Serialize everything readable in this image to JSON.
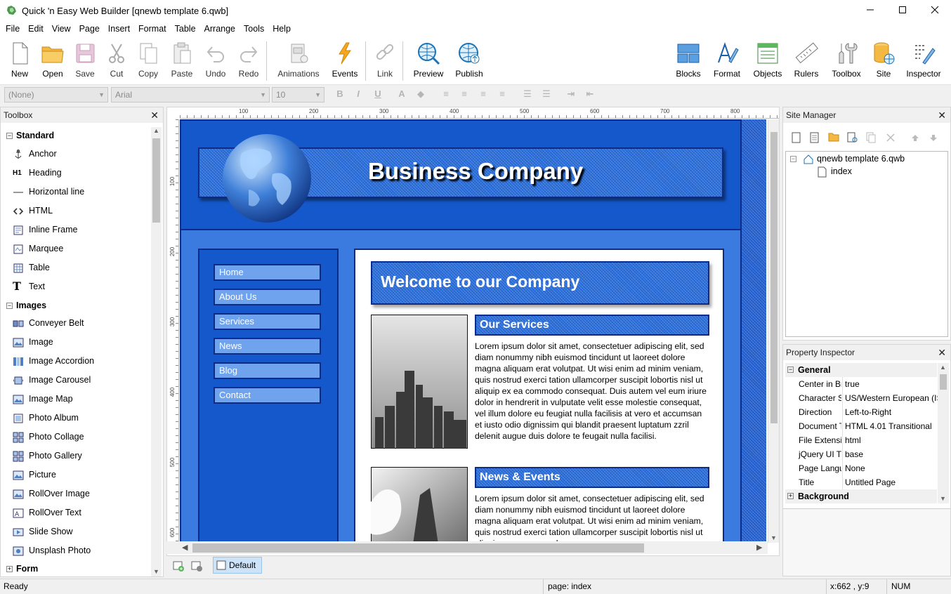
{
  "window": {
    "title": "Quick 'n Easy Web Builder [qnewb template 6.qwb]",
    "minimize": "—",
    "maximize": "☐",
    "close": "✕"
  },
  "menu": [
    "File",
    "Edit",
    "View",
    "Page",
    "Insert",
    "Format",
    "Table",
    "Arrange",
    "Tools",
    "Help"
  ],
  "toolbar": {
    "left": [
      {
        "label": "New",
        "icon": "new-page-icon",
        "enabled": true
      },
      {
        "label": "Open",
        "icon": "open-folder-icon",
        "enabled": true
      },
      {
        "label": "Save",
        "icon": "save-disk-icon",
        "enabled": false
      },
      {
        "label": "Cut",
        "icon": "scissors-icon",
        "enabled": false
      },
      {
        "label": "Copy",
        "icon": "copy-icon",
        "enabled": false
      },
      {
        "label": "Paste",
        "icon": "paste-icon",
        "enabled": false
      },
      {
        "label": "Undo",
        "icon": "undo-arrow-icon",
        "enabled": false
      },
      {
        "label": "Redo",
        "icon": "redo-arrow-icon",
        "enabled": false
      },
      {
        "label": "Animations",
        "icon": "film-icon",
        "enabled": false
      },
      {
        "label": "Events",
        "icon": "lightning-icon",
        "enabled": true
      },
      {
        "label": "Link",
        "icon": "chain-link-icon",
        "enabled": false
      },
      {
        "label": "Preview",
        "icon": "globe-magnifier-icon",
        "enabled": true
      },
      {
        "label": "Publish",
        "icon": "globe-upload-icon",
        "enabled": true
      }
    ],
    "right": [
      {
        "label": "Blocks",
        "icon": "blocks-icon"
      },
      {
        "label": "Format",
        "icon": "format-brush-icon"
      },
      {
        "label": "Objects",
        "icon": "objects-list-icon"
      },
      {
        "label": "Rulers",
        "icon": "ruler-icon"
      },
      {
        "label": "Toolbox",
        "icon": "tools-icon"
      },
      {
        "label": "Site",
        "icon": "database-globe-icon"
      },
      {
        "label": "Inspector",
        "icon": "inspector-icon"
      }
    ]
  },
  "formatbar": {
    "style": "(None)",
    "font": "Arial",
    "size": "10"
  },
  "toolbox": {
    "title": "Toolbox",
    "categories": [
      {
        "name": "Standard",
        "items": [
          "Anchor",
          "Heading",
          "Horizontal line",
          "HTML",
          "Inline Frame",
          "Marquee",
          "Table",
          "Text"
        ]
      },
      {
        "name": "Images",
        "items": [
          "Conveyer Belt",
          "Image",
          "Image Accordion",
          "Image Carousel",
          "Image Map",
          "Photo Album",
          "Photo Collage",
          "Photo Gallery",
          "Picture",
          "RollOver Image",
          "RollOver Text",
          "Slide Show",
          "Unsplash Photo"
        ]
      },
      {
        "name": "Form",
        "items": []
      }
    ]
  },
  "ruler": {
    "top_ticks": [
      "100",
      "200",
      "300",
      "400",
      "500",
      "600",
      "700",
      "800"
    ],
    "left_ticks": [
      "100",
      "200",
      "300",
      "400",
      "500",
      "600"
    ]
  },
  "webpage": {
    "banner_title": "Business Company",
    "nav": [
      "Home",
      "About Us",
      "Services",
      "News",
      "Blog",
      "Contact"
    ],
    "welcome": "Welcome to our Company",
    "sections": [
      {
        "title": "Our Services",
        "text": "Lorem ipsum dolor sit amet, consectetuer adipiscing elit, sed diam nonummy nibh euismod tincidunt ut laoreet dolore magna aliquam erat volutpat. Ut wisi enim ad minim veniam, quis nostrud exerci tation ullamcorper suscipit lobortis nisl ut aliquip ex ea commodo consequat. Duis autem vel eum iriure dolor in hendrerit in vulputate velit esse molestie consequat, vel illum dolore eu feugiat nulla facilisis at vero et accumsan et iusto odio dignissim qui blandit praesent luptatum zzril delenit augue duis dolore te feugait nulla facilisi."
      },
      {
        "title": "News & Events",
        "text": "Lorem ipsum dolor sit amet, consectetuer adipiscing elit, sed diam nonummy nibh euismod tincidunt ut laoreet dolore magna aliquam erat volutpat. Ut wisi enim ad minim veniam, quis nostrud exerci tation ullamcorper suscipit lobortis nisl ut aliquip ex ea commodo"
      }
    ]
  },
  "pagebar": {
    "default_tab": "Default"
  },
  "site_manager": {
    "title": "Site Manager",
    "root": "qnewb template 6.qwb",
    "pages": [
      "index"
    ]
  },
  "inspector": {
    "title": "Property Inspector",
    "group": "General",
    "rows": [
      {
        "key": "Center in Br",
        "value": "true"
      },
      {
        "key": "Character S",
        "value": "US/Western European (IS"
      },
      {
        "key": "Direction",
        "value": "Left-to-Right"
      },
      {
        "key": "Document T",
        "value": "HTML 4.01 Transitional"
      },
      {
        "key": "File Extensic",
        "value": "html"
      },
      {
        "key": "jQuery UI Tl",
        "value": "base"
      },
      {
        "key": "Page Langu",
        "value": "None"
      },
      {
        "key": "Title",
        "value": "Untitled Page"
      }
    ],
    "group2": "Background"
  },
  "status": {
    "left": "Ready",
    "page": "page: index",
    "coords": "x:662 , y:9",
    "num": "NUM"
  },
  "colors": {
    "page_bg": "#2a5fcb",
    "nav_button": "#6fa3ee",
    "dark_border": "#0d2c8a"
  }
}
